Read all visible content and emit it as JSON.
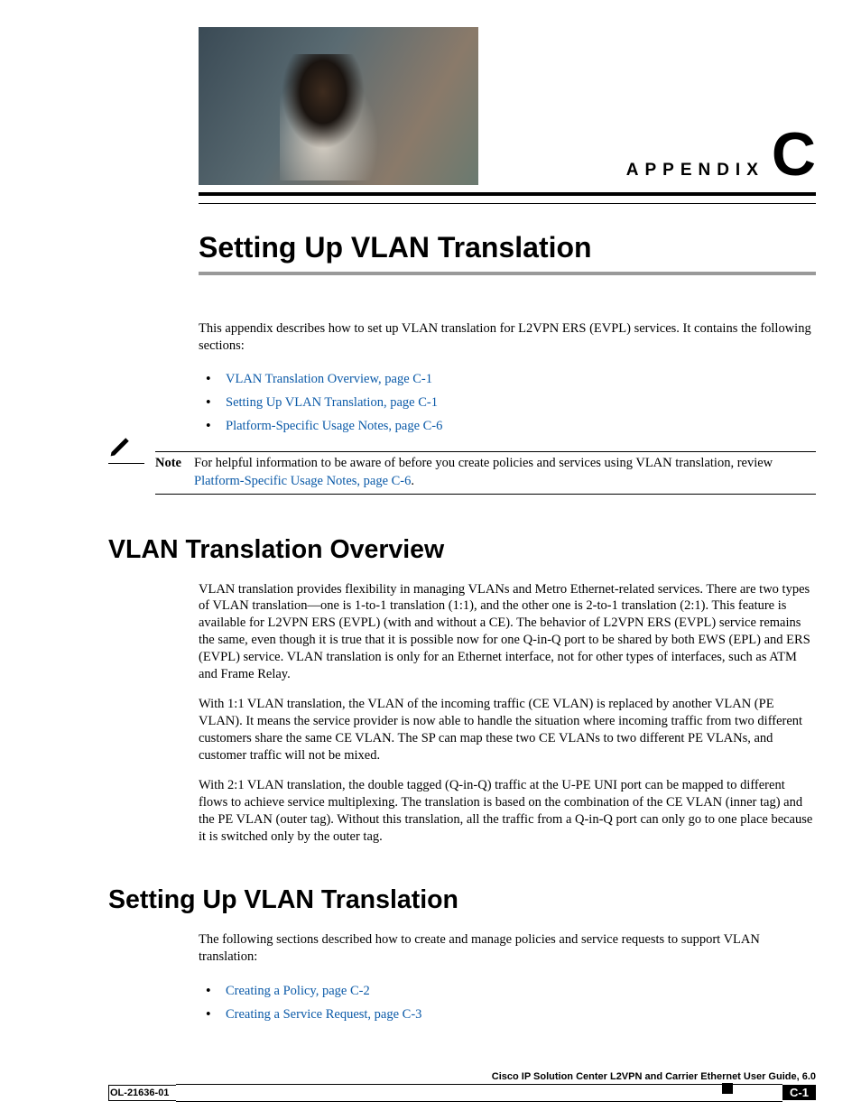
{
  "header": {
    "appendix_word": "APPENDIX",
    "appendix_letter": "C"
  },
  "chapter_title": "Setting Up VLAN Translation",
  "intro_text": "This appendix describes how to set up VLAN translation for L2VPN ERS (EVPL) services. It contains the following sections:",
  "intro_links": [
    "VLAN Translation Overview, page C-1",
    "Setting Up VLAN Translation, page C-1",
    "Platform-Specific Usage Notes, page C-6"
  ],
  "note": {
    "label": "Note",
    "text_before_link": "For helpful information to be aware of before you create policies and services using VLAN translation, review ",
    "link_text": "Platform-Specific Usage Notes, page C-6",
    "text_after_link": "."
  },
  "section1": {
    "heading": "VLAN Translation Overview",
    "p1": "VLAN translation provides flexibility in managing VLANs and Metro Ethernet-related services. There are two types of VLAN translation—one is 1-to-1 translation (1:1), and the other one is 2-to-1 translation (2:1). This feature is available for L2VPN ERS (EVPL) (with and without a CE). The behavior of L2VPN ERS (EVPL) service remains the same, even though it is true that it is possible now for one Q-in-Q port to be shared by both EWS (EPL) and ERS (EVPL) service. VLAN translation is only for an Ethernet interface, not for other types of interfaces, such as ATM and Frame Relay.",
    "p2": "With 1:1 VLAN translation, the VLAN of the incoming traffic (CE VLAN) is replaced by another VLAN (PE VLAN). It means the service provider is now able to handle the situation where incoming traffic from two different customers share the same CE VLAN. The SP can map these two CE VLANs to two different PE VLANs, and customer traffic will not be mixed.",
    "p3": "With 2:1 VLAN translation, the double tagged (Q-in-Q) traffic at the U-PE UNI port can be mapped to different flows to achieve service multiplexing. The translation is based on the combination of the CE VLAN (inner tag) and the PE VLAN (outer tag). Without this translation, all the traffic from a Q-in-Q port can only go to one place because it is switched only by the outer tag."
  },
  "section2": {
    "heading": "Setting Up VLAN Translation",
    "p1": "The following sections described how to create and manage policies and service requests to support VLAN translation:",
    "links": [
      "Creating a Policy, page C-2",
      "Creating a Service Request, page C-3"
    ]
  },
  "footer": {
    "book_title": "Cisco IP Solution Center L2VPN and Carrier Ethernet User Guide, 6.0",
    "doc_number": "OL-21636-01",
    "page_number": "C-1"
  }
}
